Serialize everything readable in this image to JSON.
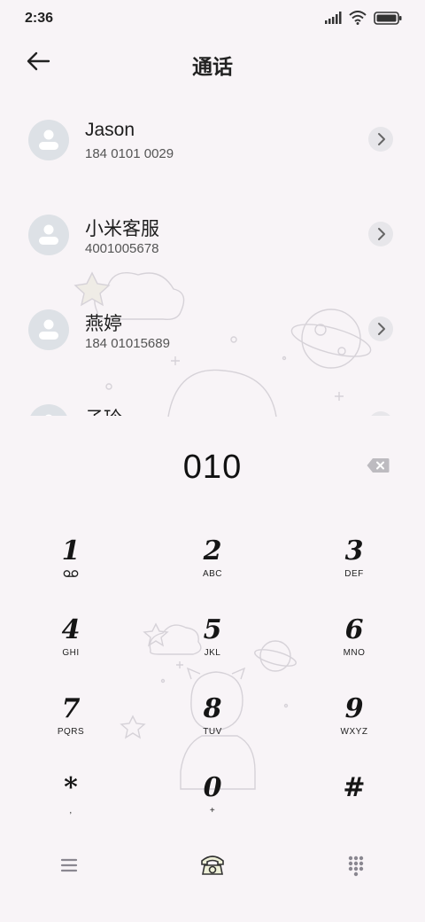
{
  "status_bar": {
    "time": "2:36",
    "icons": [
      "signal-icon",
      "wifi-icon",
      "battery-icon"
    ]
  },
  "header": {
    "title": "通话",
    "back_icon": "back-arrow-icon"
  },
  "contacts": [
    {
      "name": "Jason",
      "number": "184 0101 0029"
    },
    {
      "name": "小米客服",
      "number": "4001005678"
    },
    {
      "name": "燕婷",
      "number": "184 01015689"
    },
    {
      "name": "子玲",
      "number": ""
    }
  ],
  "dialer": {
    "number": "010",
    "backspace_icon": "backspace-icon"
  },
  "keypad": [
    {
      "digit": "1",
      "letters": "",
      "icon": "voicemail-icon"
    },
    {
      "digit": "2",
      "letters": "ABC"
    },
    {
      "digit": "3",
      "letters": "DEF"
    },
    {
      "digit": "4",
      "letters": "GHI"
    },
    {
      "digit": "5",
      "letters": "JKL"
    },
    {
      "digit": "6",
      "letters": "MNO"
    },
    {
      "digit": "7",
      "letters": "PQRS"
    },
    {
      "digit": "8",
      "letters": "TUV"
    },
    {
      "digit": "9",
      "letters": "WXYZ"
    },
    {
      "digit": "*",
      "letters": ","
    },
    {
      "digit": "0",
      "letters": "+"
    },
    {
      "digit": "#",
      "letters": ""
    }
  ],
  "bottom_bar": {
    "icons": [
      "menu-icon",
      "telephone-icon",
      "dialpad-icon"
    ]
  },
  "colors": {
    "background": "#f8f4f7",
    "avatar_bg": "#dde1e6",
    "chevron_bg": "#e7e6ea",
    "text_primary": "#1b1b1b",
    "text_secondary": "#555555"
  }
}
